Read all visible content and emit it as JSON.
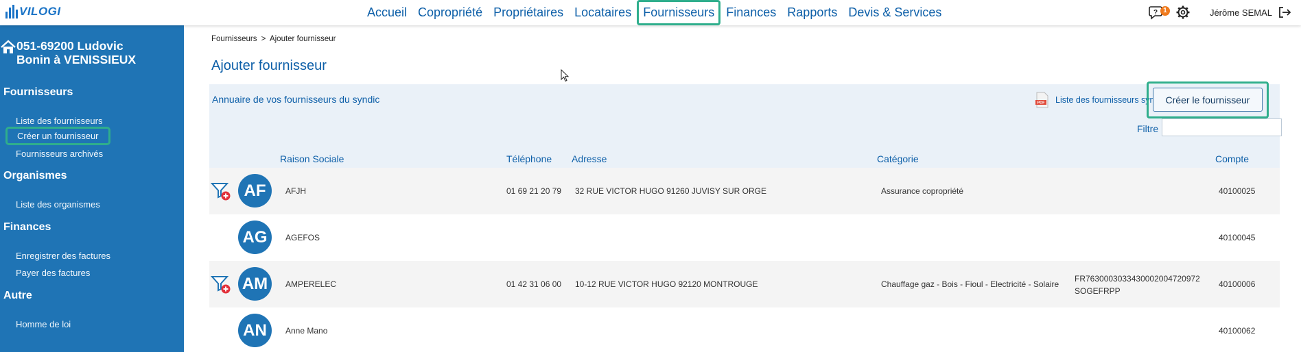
{
  "app": {
    "logo_text": "VILOGI",
    "nav": [
      {
        "label": "Accueil"
      },
      {
        "label": "Copropriété"
      },
      {
        "label": "Propriétaires"
      },
      {
        "label": "Locataires"
      },
      {
        "label": "Fournisseurs",
        "active": true
      },
      {
        "label": "Finances"
      },
      {
        "label": "Rapports"
      },
      {
        "label": "Devis & Services"
      }
    ],
    "notifications_count": "1",
    "user_name": "Jérôme SEMAL",
    "accent_color": "#1f74b5",
    "highlight_color": "#2fae8c"
  },
  "sidebar": {
    "title_line1": "051-69200 Ludovic",
    "title_line2": "Bonin à VENISSIEUX",
    "sections": [
      {
        "title": "Fournisseurs",
        "items": [
          "Liste des fournisseurs",
          "Créer un fournisseur",
          "Fournisseurs archivés"
        ]
      },
      {
        "title": "Organismes",
        "items": [
          "Liste des organismes"
        ]
      },
      {
        "title": "Finances",
        "items": [
          "Enregistrer des factures",
          "Payer des factures"
        ]
      },
      {
        "title": "Autre",
        "items": [
          "Homme de loi"
        ]
      }
    ]
  },
  "main": {
    "breadcrumb_link": "Fournisseurs",
    "breadcrumb_sep": ">",
    "breadcrumb_current": "Ajouter fournisseur",
    "page_title": "Ajouter fournisseur",
    "panel_title": "Annuaire de vos fournisseurs du syndic",
    "pdf_icon_label": "PDF",
    "pdf_link": "Liste des fournisseurs syndic",
    "create_button": "Créer le fournisseur",
    "filter_label": "Filtre",
    "filter_value": "",
    "columns": {
      "raison_sociale": "Raison Sociale",
      "telephone": "Téléphone",
      "adresse": "Adresse",
      "categorie": "Catégorie",
      "compte": "Compte"
    },
    "rows": [
      {
        "initials": "AF",
        "name": "AFJH",
        "phone": "01 69 21 20 79",
        "address": "32 RUE VICTOR HUGO 91260 JUVISY SUR ORGE",
        "category": "Assurance copropriété",
        "iban": "",
        "bank": "",
        "account": "40100025",
        "has_filter_icon": true
      },
      {
        "initials": "AG",
        "name": "AGEFOS",
        "phone": "",
        "address": "",
        "category": "",
        "iban": "",
        "bank": "",
        "account": "40100045",
        "has_filter_icon": false
      },
      {
        "initials": "AM",
        "name": "AMPERELEC",
        "phone": "01 42 31 06 00",
        "address": "10-12 RUE VICTOR HUGO 92120 MONTROUGE",
        "category": "Chauffage gaz - Bois - Fioul - Electricité - Solaire",
        "iban": "FR7630003033430002004720972",
        "bank": "SOGEFRPP",
        "account": "40100006",
        "has_filter_icon": true
      },
      {
        "initials": "AN",
        "name": "Anne Mano",
        "phone": "",
        "address": "",
        "category": "",
        "iban": "",
        "bank": "",
        "account": "40100062",
        "has_filter_icon": false
      }
    ]
  }
}
